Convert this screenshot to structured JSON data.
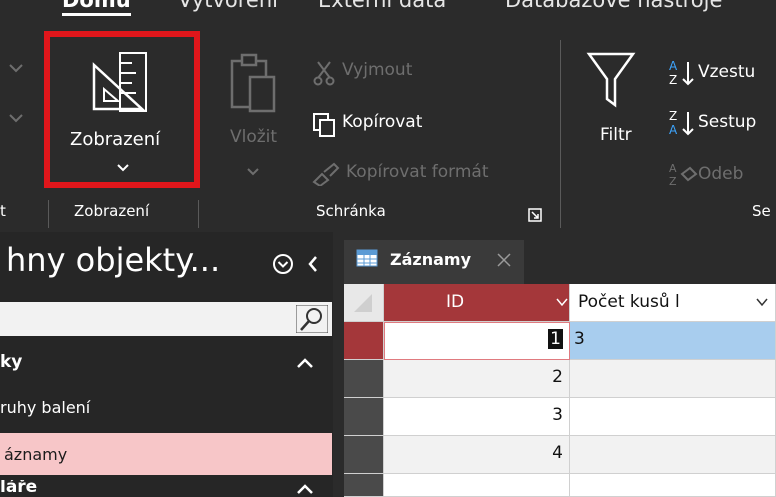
{
  "ribbon": {
    "tabs": [
      "Domů",
      "Vytvoření",
      "Externí data",
      "Databázové nástroje"
    ],
    "active_tab": "Domů",
    "view_button_label": "Zobrazení",
    "view_group_label": "Zobrazení",
    "paste_label": "Vložit",
    "cut_label": "Vyjmout",
    "copy_label": "Kopírovat",
    "format_painter_label": "Kopírovat formát",
    "clipboard_group_label": "Schránka",
    "filter_label": "Filtr",
    "sort_asc_label": "Vzestu",
    "sort_desc_label": "Sestup",
    "remove_sort_label": "Odeb",
    "left_group_label_fragment": "t",
    "right_group_label_fragment": "Se",
    "accent_color": "#e0161b"
  },
  "nav": {
    "title": "hny objekty...",
    "section_tables": "ky",
    "items": [
      "ruhy balení",
      "áznamy"
    ],
    "section_forms": "láře"
  },
  "document": {
    "tab_label": "Záznamy",
    "columns": [
      "ID",
      "Počet kusů l"
    ],
    "rows": [
      {
        "id": "1",
        "count": "3"
      },
      {
        "id": "2",
        "count": ""
      },
      {
        "id": "3",
        "count": ""
      },
      {
        "id": "4",
        "count": ""
      }
    ]
  }
}
